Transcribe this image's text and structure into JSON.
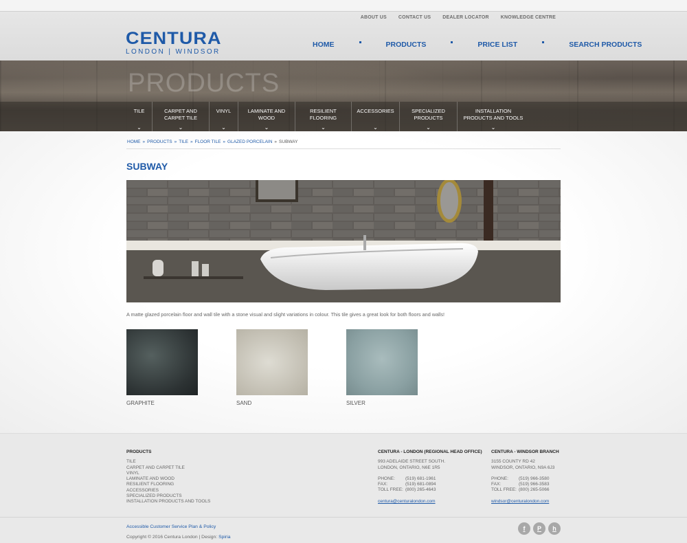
{
  "utility_nav": [
    "ABOUT US",
    "CONTACT US",
    "DEALER LOCATOR",
    "KNOWLEDGE CENTRE"
  ],
  "logo": {
    "main": "CENTURA",
    "sub": "LONDON | WINDSOR"
  },
  "main_nav": [
    "HOME",
    "PRODUCTS",
    "PRICE LIST",
    "SEARCH PRODUCTS"
  ],
  "hero": {
    "title": "PRODUCTS"
  },
  "sub_nav": [
    "TILE",
    "CARPET AND\nCARPET TILE",
    "VINYL",
    "LAMINATE AND\nWOOD",
    "RESILIENT\nFLOORING",
    "ACCESSORIES",
    "SPECIALIZED\nPRODUCTS",
    "INSTALLATION\nPRODUCTS AND TOOLS"
  ],
  "breadcrumb": {
    "links": [
      "HOME",
      "PRODUCTS",
      "TILE",
      "FLOOR TILE",
      "GLAZED PORCELAIN"
    ],
    "current": "SUBWAY"
  },
  "page_title": "SUBWAY",
  "description": "A matte glazed porcelain floor and wall tile with a stone visual and slight variations in colour. This tile gives a great look for both floors and walls!",
  "swatches": [
    {
      "name": "GRAPHITE",
      "color": "#33393b"
    },
    {
      "name": "SAND",
      "color": "#c9c6bb"
    },
    {
      "name": "SILVER",
      "color": "#8fa2a4"
    }
  ],
  "footer": {
    "products": {
      "heading": "PRODUCTS",
      "items": [
        "TILE",
        "CARPET AND CARPET TILE",
        "VINYL",
        "LAMINATE AND WOOD",
        "RESILIENT FLOORING",
        "ACCESSORIES",
        "SPECIALIZED PRODUCTS",
        "INSTALLATION PRODUCTS AND TOOLS"
      ]
    },
    "london": {
      "heading": "CENTURA - LONDON (REGIONAL HEAD OFFICE)",
      "address1": "993 ADELAIDE STREET SOUTH.",
      "address2": "LONDON, ONTARIO, N6E 1R5",
      "phone_label": "PHONE:",
      "phone": "(519) 681-1961",
      "fax_label": "FAX:",
      "fax": "(519) 681-0894",
      "toll_label": "TOLL FREE:",
      "toll": "(800) 265-4643",
      "email": "centura@centuralondon.com"
    },
    "windsor": {
      "heading": "CENTURA - WINDSOR BRANCH",
      "address1": "3155 COUNTY RD 42",
      "address2": "WINDSOR, ONTARIO, N9A 6J3",
      "phone_label": "PHONE:",
      "phone": "(519) 966-3580",
      "fax_label": "FAX:",
      "fax": "(519) 966-3583",
      "toll_label": "TOLL FREE:",
      "toll": "(800) 265-5066",
      "email": "windsor@centuralondon.com"
    },
    "accessibility_link": "Accessible Customer Service Plan & Policy",
    "copyright": "Copyright © 2016 Centura London | Design: ",
    "design_link": "Spiria"
  },
  "colors": {
    "brand_blue": "#1f5aa8"
  },
  "social_icons": [
    "facebook-icon",
    "pinterest-icon",
    "houzz-icon"
  ]
}
